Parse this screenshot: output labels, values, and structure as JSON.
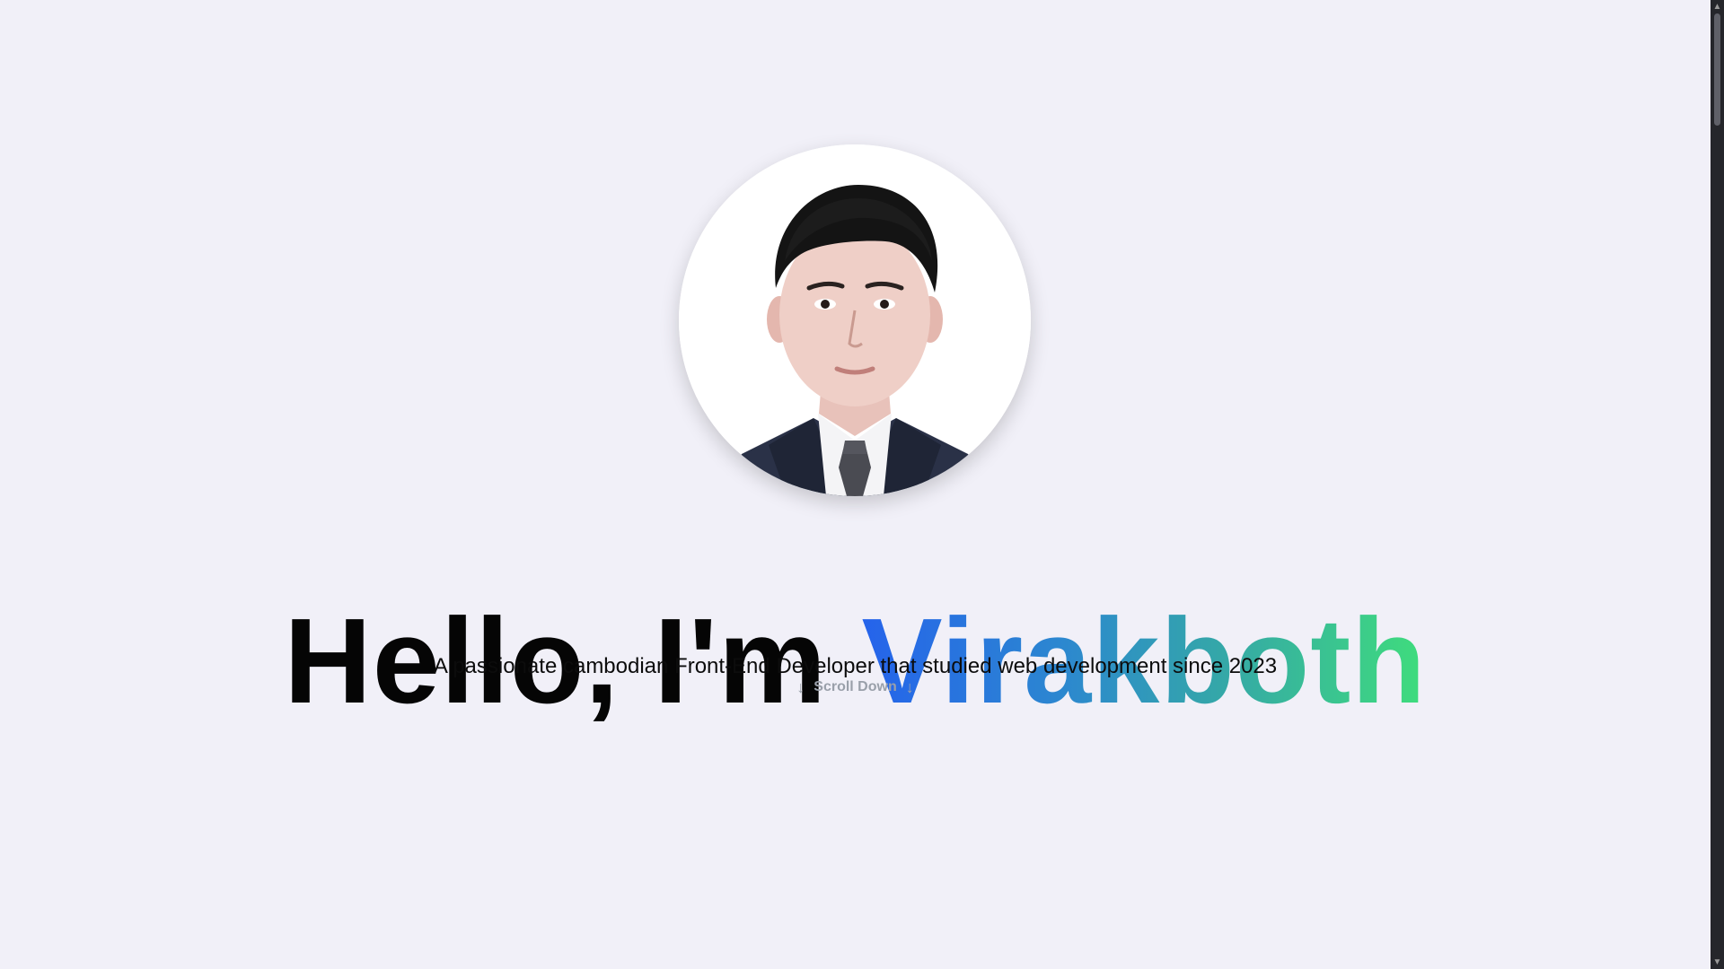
{
  "hero": {
    "greeting": "Hello, I'm ",
    "name": "Virakboth",
    "subtitle": "A passionate cambodian Front-End Developer that studied web development since 2023",
    "scroll_label": "Scroll Down",
    "scroll_icon": "arrow-down-icon"
  },
  "profile": {
    "photo_icon": "profile-photo",
    "photo_description_icon": "portrait-icon"
  },
  "colors": {
    "background": "#f1f0f8",
    "heading": "#050505",
    "name_gradient_start": "#2563eb",
    "name_gradient_end": "#3fdd7c",
    "scroll_hint": "#9aa0aa",
    "scrollbar_track": "#25262b",
    "scrollbar_thumb": "#5f6068"
  },
  "scrollbar": {
    "up_icon": "scroll-up-icon",
    "down_icon": "scroll-down-icon"
  }
}
